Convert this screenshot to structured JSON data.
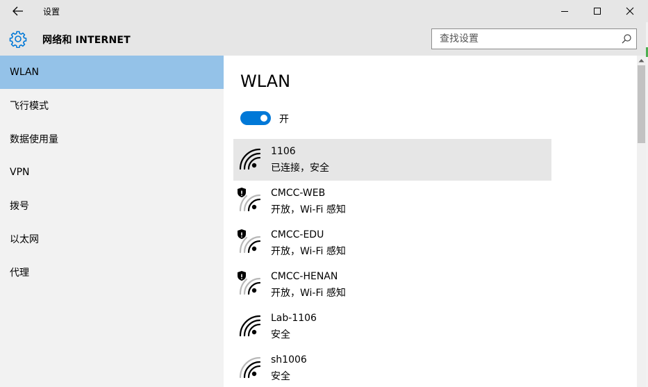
{
  "window": {
    "title": "设置"
  },
  "header": {
    "title": "网络和 INTERNET",
    "search_placeholder": "查找设置"
  },
  "sidebar": {
    "items": [
      {
        "label": "WLAN",
        "active": true
      },
      {
        "label": "飞行模式",
        "active": false
      },
      {
        "label": "数据使用量",
        "active": false
      },
      {
        "label": "VPN",
        "active": false
      },
      {
        "label": "拨号",
        "active": false
      },
      {
        "label": "以太网",
        "active": false
      },
      {
        "label": "代理",
        "active": false
      }
    ]
  },
  "main": {
    "title": "WLAN",
    "toggle_label": "开",
    "toggle_on": true,
    "networks": [
      {
        "name": "1106",
        "status": "已连接，安全",
        "open": false,
        "connected": true
      },
      {
        "name": "CMCC-WEB",
        "status": "开放，Wi-Fi 感知",
        "open": true,
        "connected": false
      },
      {
        "name": "CMCC-EDU",
        "status": "开放，Wi-Fi 感知",
        "open": true,
        "connected": false
      },
      {
        "name": "CMCC-HENAN",
        "status": "开放，Wi-Fi 感知",
        "open": true,
        "connected": false
      },
      {
        "name": "Lab-1106",
        "status": "安全",
        "open": false,
        "connected": false
      },
      {
        "name": "sh1006",
        "status": "安全",
        "open": false,
        "connected": false
      }
    ]
  },
  "colors": {
    "accent": "#0078d7",
    "nav_active": "#94c2e8",
    "chrome": "#e6e6e6",
    "sidebar": "#f2f2f2"
  }
}
